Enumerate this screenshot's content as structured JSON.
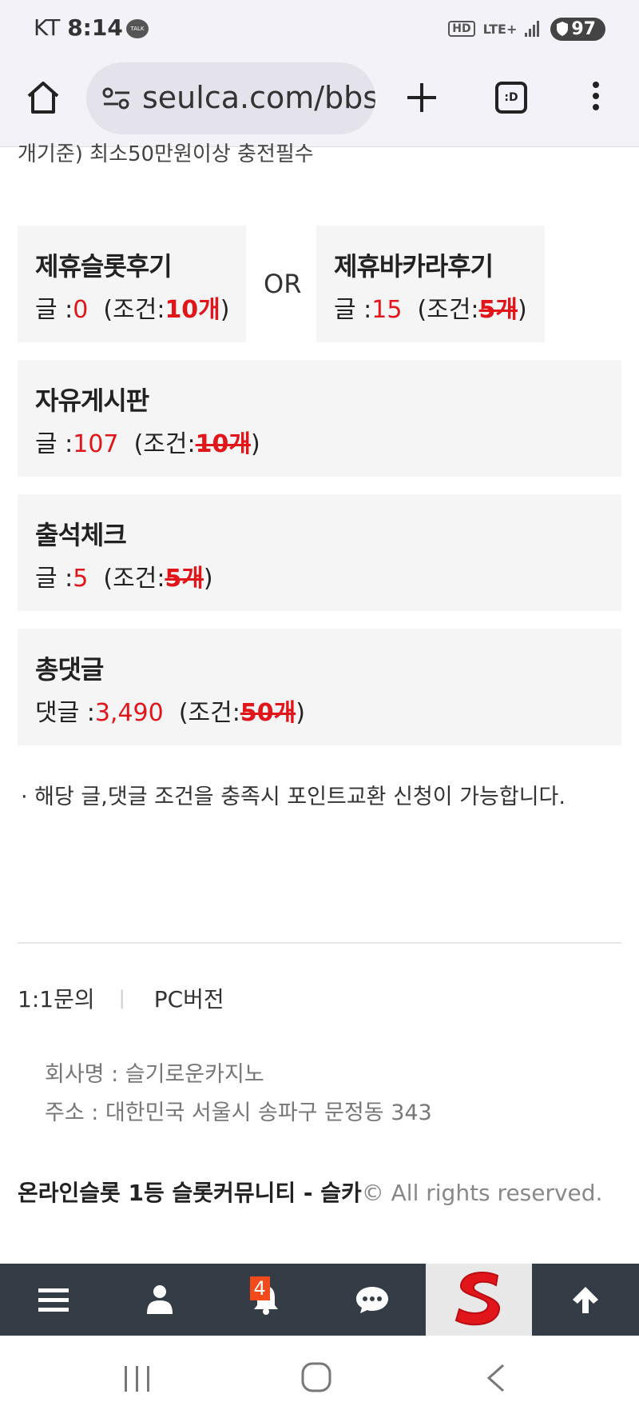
{
  "status_bar": {
    "carrier": "KT",
    "time": "8:14",
    "talk_label": "TALK",
    "hd_label": "HD",
    "network": "LTE+",
    "battery": "97"
  },
  "browser": {
    "url": "seulca.com/bbs",
    "tabs_label": ":D"
  },
  "content": {
    "cut_off_line": "개기준) 최소50만원이상 충전필수",
    "or_label": "OR",
    "cards": [
      {
        "title": "제휴슬롯후기",
        "count_prefix": "글 :",
        "count": "0",
        "cond_prefix": "(조건:",
        "cond_value": "10개",
        "cond_suffix": ")"
      },
      {
        "title": "제휴바카라후기",
        "count_prefix": "글 :",
        "count": "15",
        "cond_prefix": "(조건:",
        "cond_value": "5개",
        "cond_suffix": ")"
      },
      {
        "title": "자유게시판",
        "count_prefix": "글 :",
        "count": "107",
        "cond_prefix": "(조건:",
        "cond_value": "10개",
        "cond_suffix": ")"
      },
      {
        "title": "출석체크",
        "count_prefix": "글 :",
        "count": "5",
        "cond_prefix": "(조건:",
        "cond_value": "5개",
        "cond_suffix": ")"
      },
      {
        "title": "총댓글",
        "count_prefix": "댓글 :",
        "count": "3,490",
        "cond_prefix": "(조건:",
        "cond_value": "50개",
        "cond_suffix": ")"
      }
    ],
    "notice": "· 해당 글,댓글 조건을 충족시 포인트교환 신청이 가능합니다."
  },
  "footer": {
    "link_inquiry": "1:1문의",
    "separator": "|",
    "link_pc": "PC버전",
    "company_name": "회사명 : 슬기로운카지노",
    "address": "주소 : 대한민국 서울시 송파구 문정동 343",
    "copyright_bold": "온라인슬롯 1등 슬롯커뮤니티 - 슬카",
    "copyright_rest": "© All rights reserved."
  },
  "bottom_nav": {
    "notification_count": "4"
  },
  "colors": {
    "accent_red": "#e0161b",
    "nav_bg": "#343d45",
    "badge": "#f24a1d"
  }
}
